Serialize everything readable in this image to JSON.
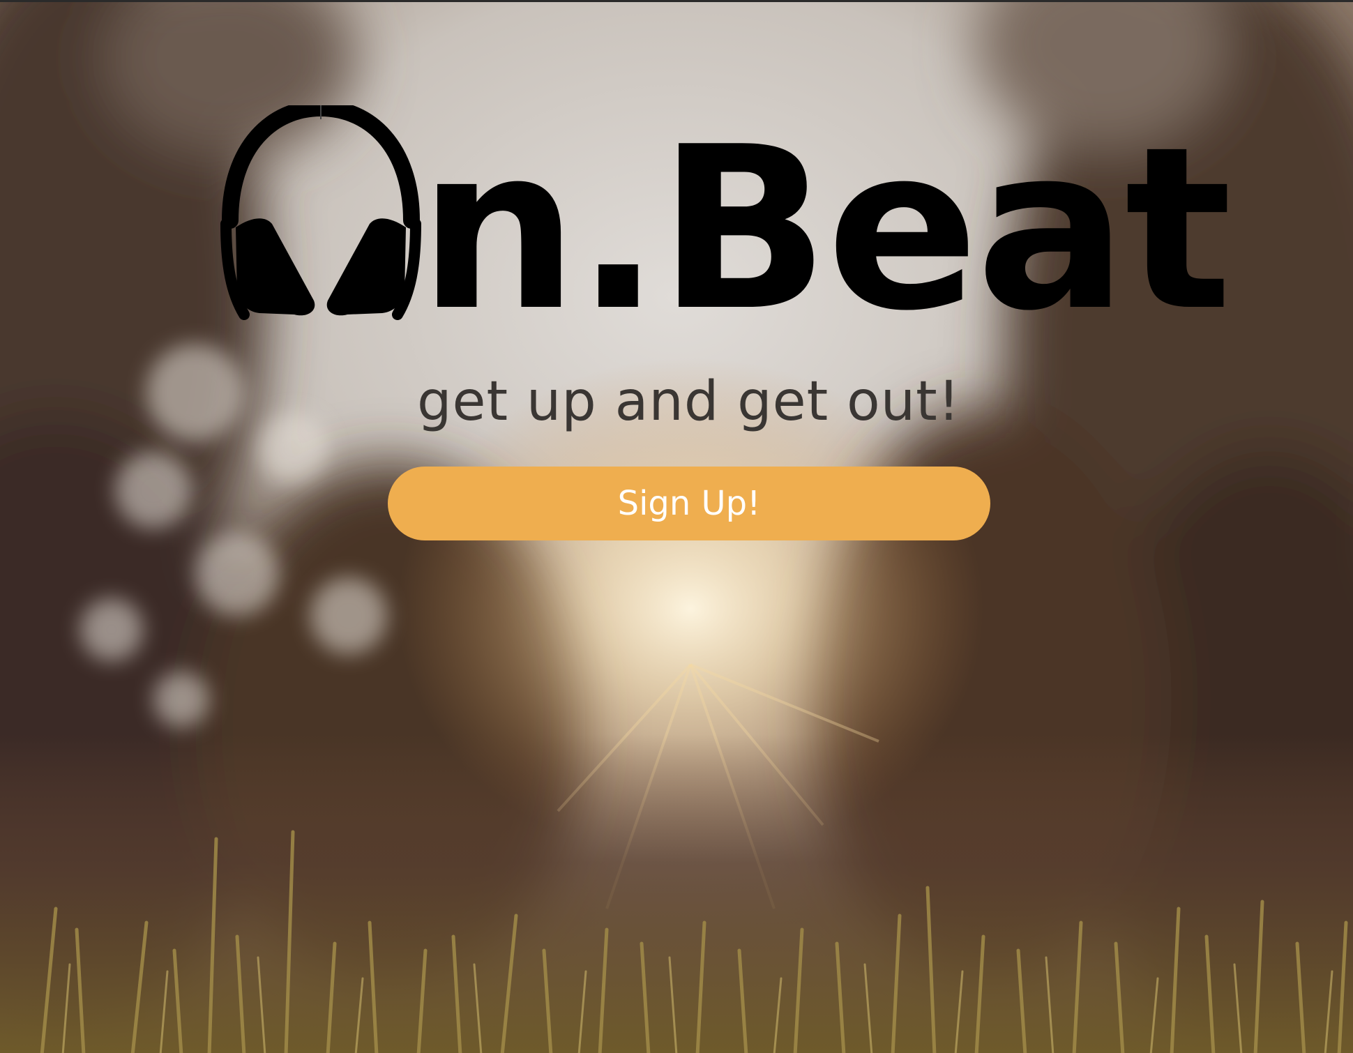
{
  "brand": {
    "logo_icon": "headphones-icon",
    "name": "n.Beat"
  },
  "hero": {
    "tagline": "get up and get out!",
    "signup_label": "Sign Up!"
  },
  "colors": {
    "button": "#efae4f",
    "button_text": "#ffffff",
    "logo": "#000000",
    "tagline": "#3a3633"
  }
}
